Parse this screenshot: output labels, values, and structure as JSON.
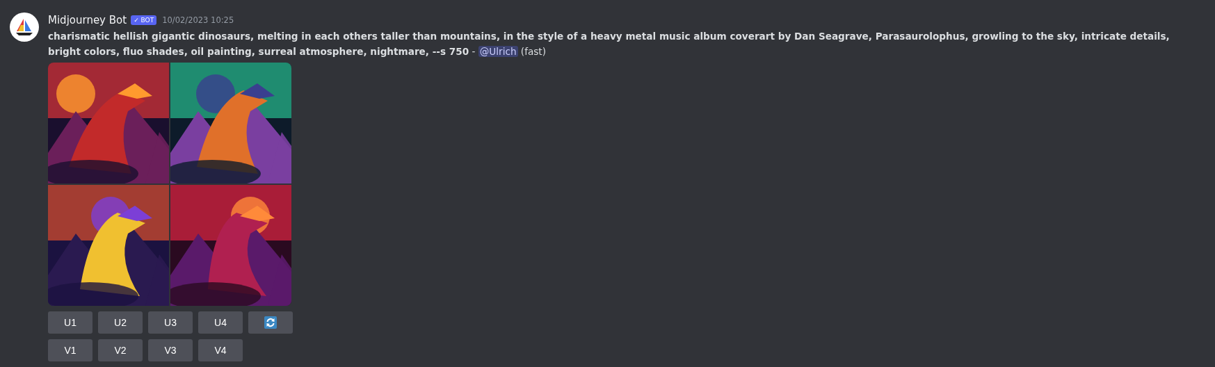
{
  "message": {
    "author": "Midjourney Bot",
    "badge": "✓ BOT",
    "timestamp": "10/02/2023 10:25",
    "prompt": "**charismatic hellish gigantic dinosaurs, melting in each others taller than mountains, in the style of a heavy metal music album coverart by Dan Seagrave, Parasaurolophus, growling to the sky, intricate details, bright colors, fluo shades, oil painting, surreal atmosphere, nightmare, --s 750** - ",
    "mention": "@Ulrich",
    "suffix": " (fast)",
    "images": [
      {
        "kind": "picture"
      },
      {
        "kind": "picture"
      },
      {
        "kind": "picture"
      },
      {
        "kind": "picture"
      }
    ],
    "button_rows": [
      [
        {
          "kind": "text",
          "label": "U1"
        },
        {
          "kind": "text",
          "label": "U2"
        },
        {
          "kind": "text",
          "label": "U3"
        },
        {
          "kind": "text",
          "label": "U4"
        },
        {
          "kind": "refresh"
        }
      ],
      [
        {
          "kind": "text",
          "label": "V1"
        },
        {
          "kind": "text",
          "label": "V2"
        },
        {
          "kind": "text",
          "label": "V3"
        },
        {
          "kind": "text",
          "label": "V4"
        }
      ]
    ]
  }
}
